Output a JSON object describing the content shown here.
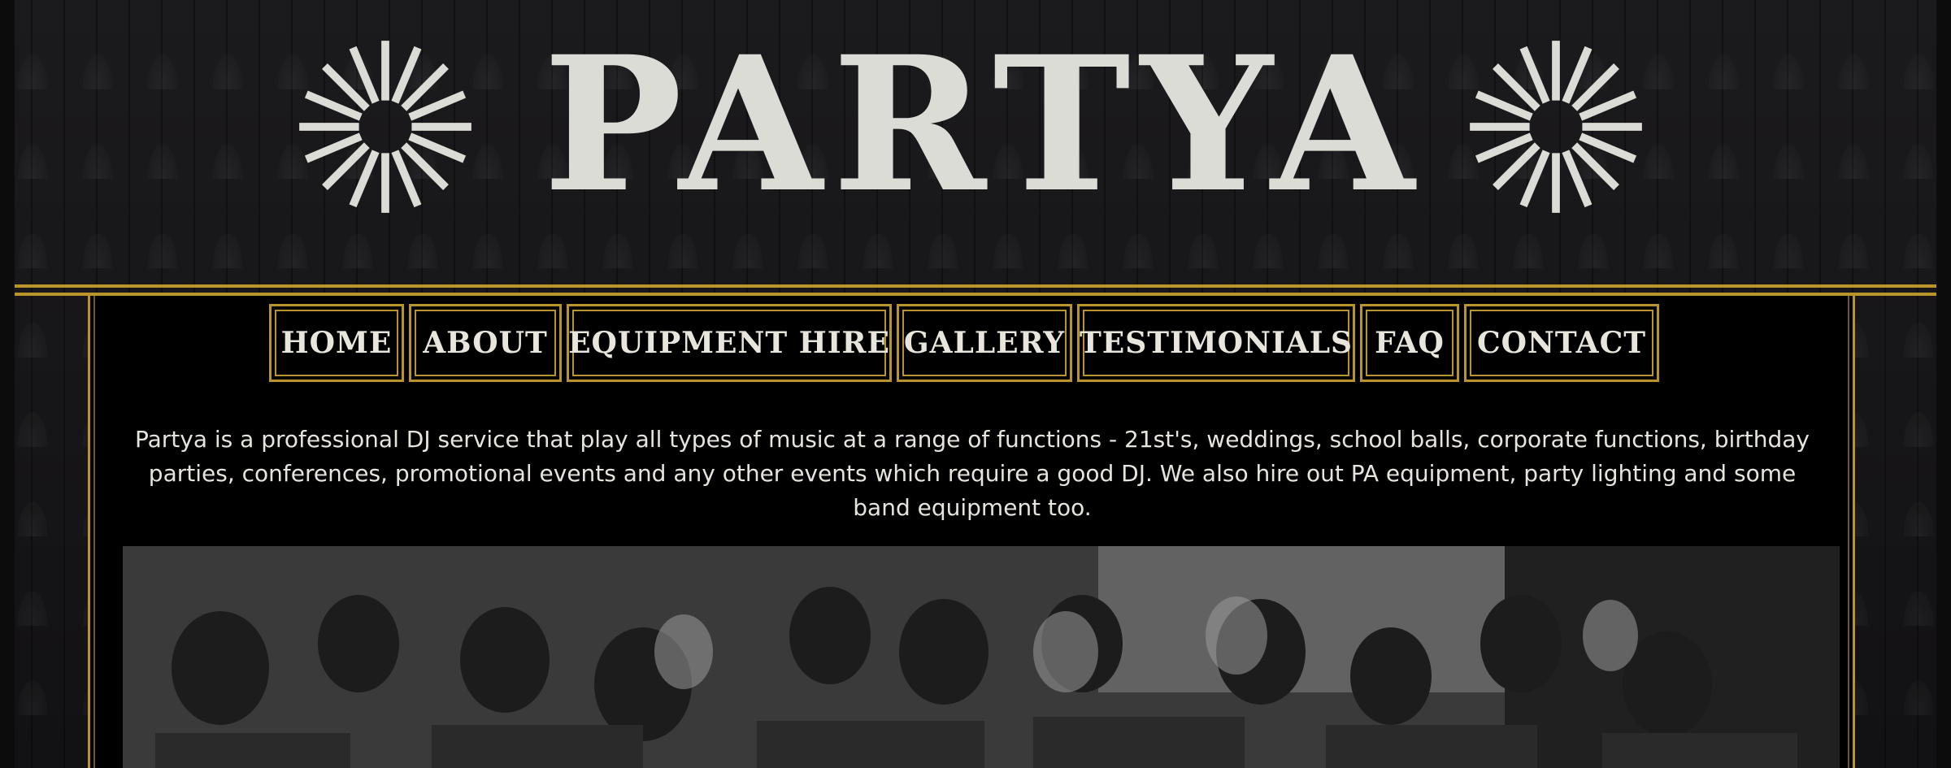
{
  "site": {
    "logo_text": "PARTYA"
  },
  "nav": {
    "items": [
      {
        "label": "HOME"
      },
      {
        "label": "ABOUT"
      },
      {
        "label": "EQUIPMENT HIRE"
      },
      {
        "label": "GALLERY"
      },
      {
        "label": "TESTIMONIALS"
      },
      {
        "label": "FAQ"
      },
      {
        "label": "CONTACT"
      }
    ]
  },
  "intro": {
    "text": "Partya is a professional DJ service that play all types of music at a range of functions - 21st's, weddings, school balls, corporate functions, birthday parties, conferences, promotional events and any other events which require a good DJ. We also hire out PA equipment, party lighting and some band equipment too."
  },
  "colors": {
    "gold": "#b8942a",
    "logo": "#dcdcd6",
    "background": "#141314",
    "panel": "#000000"
  },
  "icons": [
    "starburst-icon"
  ]
}
